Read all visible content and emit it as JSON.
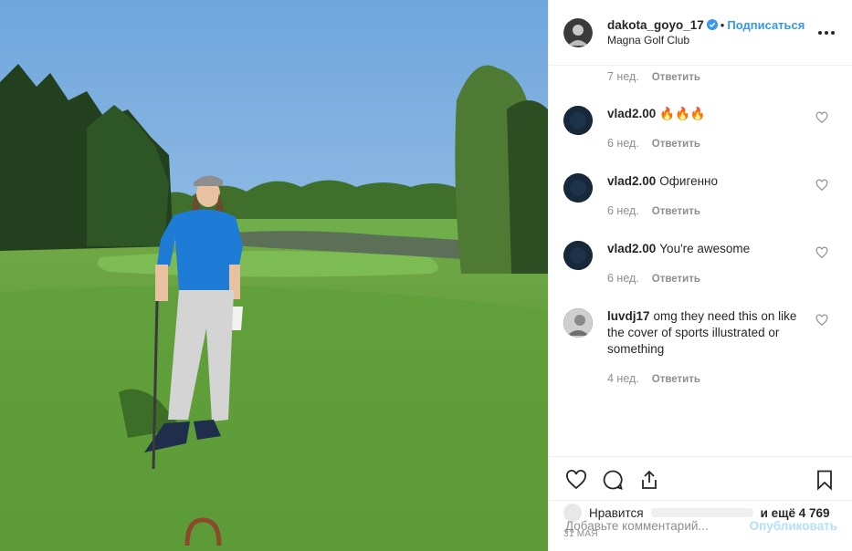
{
  "header": {
    "username": "dakota_goyo_17",
    "separator": "•",
    "follow_label": "Подписаться",
    "location": "Magna Golf Club",
    "more_icon": "more-horizontal-icon"
  },
  "top_meta": {
    "time": "7 нед.",
    "reply": "Ответить"
  },
  "comments": [
    {
      "user": "vlad2.00",
      "text": "🔥🔥🔥",
      "time": "6 нед.",
      "reply": "Ответить"
    },
    {
      "user": "vlad2.00",
      "text": "Офигенно",
      "time": "6 нед.",
      "reply": "Ответить"
    },
    {
      "user": "vlad2.00",
      "text": "You're awesome",
      "time": "6 нед.",
      "reply": "Ответить"
    },
    {
      "user": "luvdj17",
      "text": "omg they need this on like the cover of sports illustrated or something",
      "time": "4 нед.",
      "reply": "Ответить"
    }
  ],
  "likes": {
    "prefix": "Нравится",
    "suffix": "и ещё 4 769"
  },
  "date": "31 мая",
  "add_comment": {
    "placeholder": "Добавьте комментарий...",
    "publish_label": "Опубликовать"
  },
  "colors": {
    "link": "#3897f0",
    "publish_disabled": "#b2dffc",
    "muted": "#8e8e8e",
    "sky": "#7fb0df",
    "grass": "#5d9a3a"
  }
}
